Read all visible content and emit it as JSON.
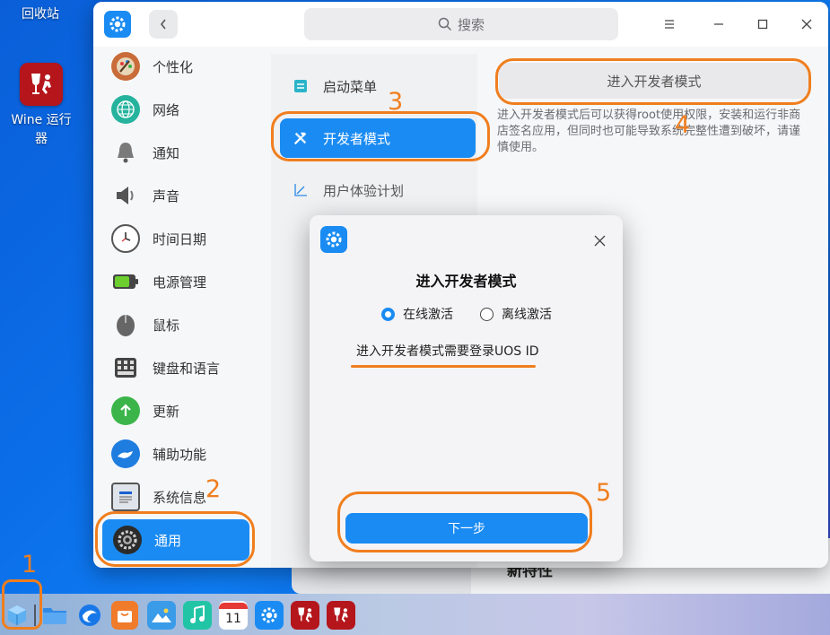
{
  "desktop": {
    "recycle_bin": "回收站",
    "wine_line1": "Wine 运行",
    "wine_line2": "器"
  },
  "background_window": {
    "title": "新特性"
  },
  "window": {
    "search_placeholder": "搜索",
    "sidebar": [
      {
        "label": "个性化",
        "icon": "palette-icon"
      },
      {
        "label": "网络",
        "icon": "network-globe-icon"
      },
      {
        "label": "通知",
        "icon": "bell-icon"
      },
      {
        "label": "声音",
        "icon": "speaker-icon"
      },
      {
        "label": "时间日期",
        "icon": "clock-icon"
      },
      {
        "label": "电源管理",
        "icon": "battery-icon"
      },
      {
        "label": "鼠标",
        "icon": "mouse-icon"
      },
      {
        "label": "键盘和语言",
        "icon": "keyboard-icon"
      },
      {
        "label": "更新",
        "icon": "update-arrow-icon"
      },
      {
        "label": "辅助功能",
        "icon": "hand-icon"
      },
      {
        "label": "系统信息",
        "icon": "uos-info-icon"
      },
      {
        "label": "通用",
        "icon": "gear-icon",
        "active": true
      }
    ],
    "sub_menu": [
      {
        "label": "启动菜单",
        "icon": "menu-list-icon"
      },
      {
        "label": "开发者模式",
        "icon": "tools-icon",
        "active": true
      },
      {
        "label": "用户体验计划",
        "icon": "chart-trend-icon"
      }
    ],
    "enter_dev_button": "进入开发者模式",
    "description": "进入开发者模式后可以获得root使用权限，安装和运行非商店签名应用，但同时也可能导致系统完整性遭到破坏，请谨慎使用。"
  },
  "dialog": {
    "title": "进入开发者模式",
    "options": [
      {
        "label": "在线激活",
        "selected": true
      },
      {
        "label": "离线激活",
        "selected": false
      }
    ],
    "message": "进入开发者模式需要登录UOS ID",
    "next_button": "下一步"
  },
  "dock": {
    "items": [
      "launcher-icon",
      "file-manager-icon",
      "browser-icon",
      "app-store-icon",
      "image-viewer-icon",
      "music-icon",
      "calendar-icon",
      "control-center-icon",
      "wine-app-icon",
      "wine-app-icon-2"
    ],
    "calendar_day": "11"
  },
  "annotations": [
    "1",
    "2",
    "3",
    "4",
    "5"
  ],
  "colors": {
    "accent": "#1a8bf2",
    "annotation": "#f07e1e"
  }
}
